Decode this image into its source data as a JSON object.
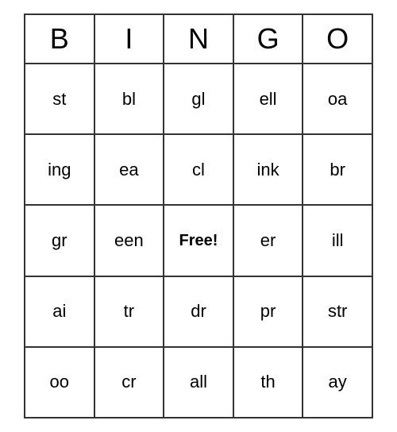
{
  "header": {
    "cells": [
      "B",
      "I",
      "N",
      "G",
      "O"
    ]
  },
  "rows": [
    [
      "st",
      "bl",
      "gl",
      "ell",
      "oa"
    ],
    [
      "ing",
      "ea",
      "cl",
      "ink",
      "br"
    ],
    [
      "gr",
      "een",
      "Free!",
      "er",
      "ill"
    ],
    [
      "ai",
      "tr",
      "dr",
      "pr",
      "str"
    ],
    [
      "oo",
      "cr",
      "all",
      "th",
      "ay"
    ]
  ]
}
